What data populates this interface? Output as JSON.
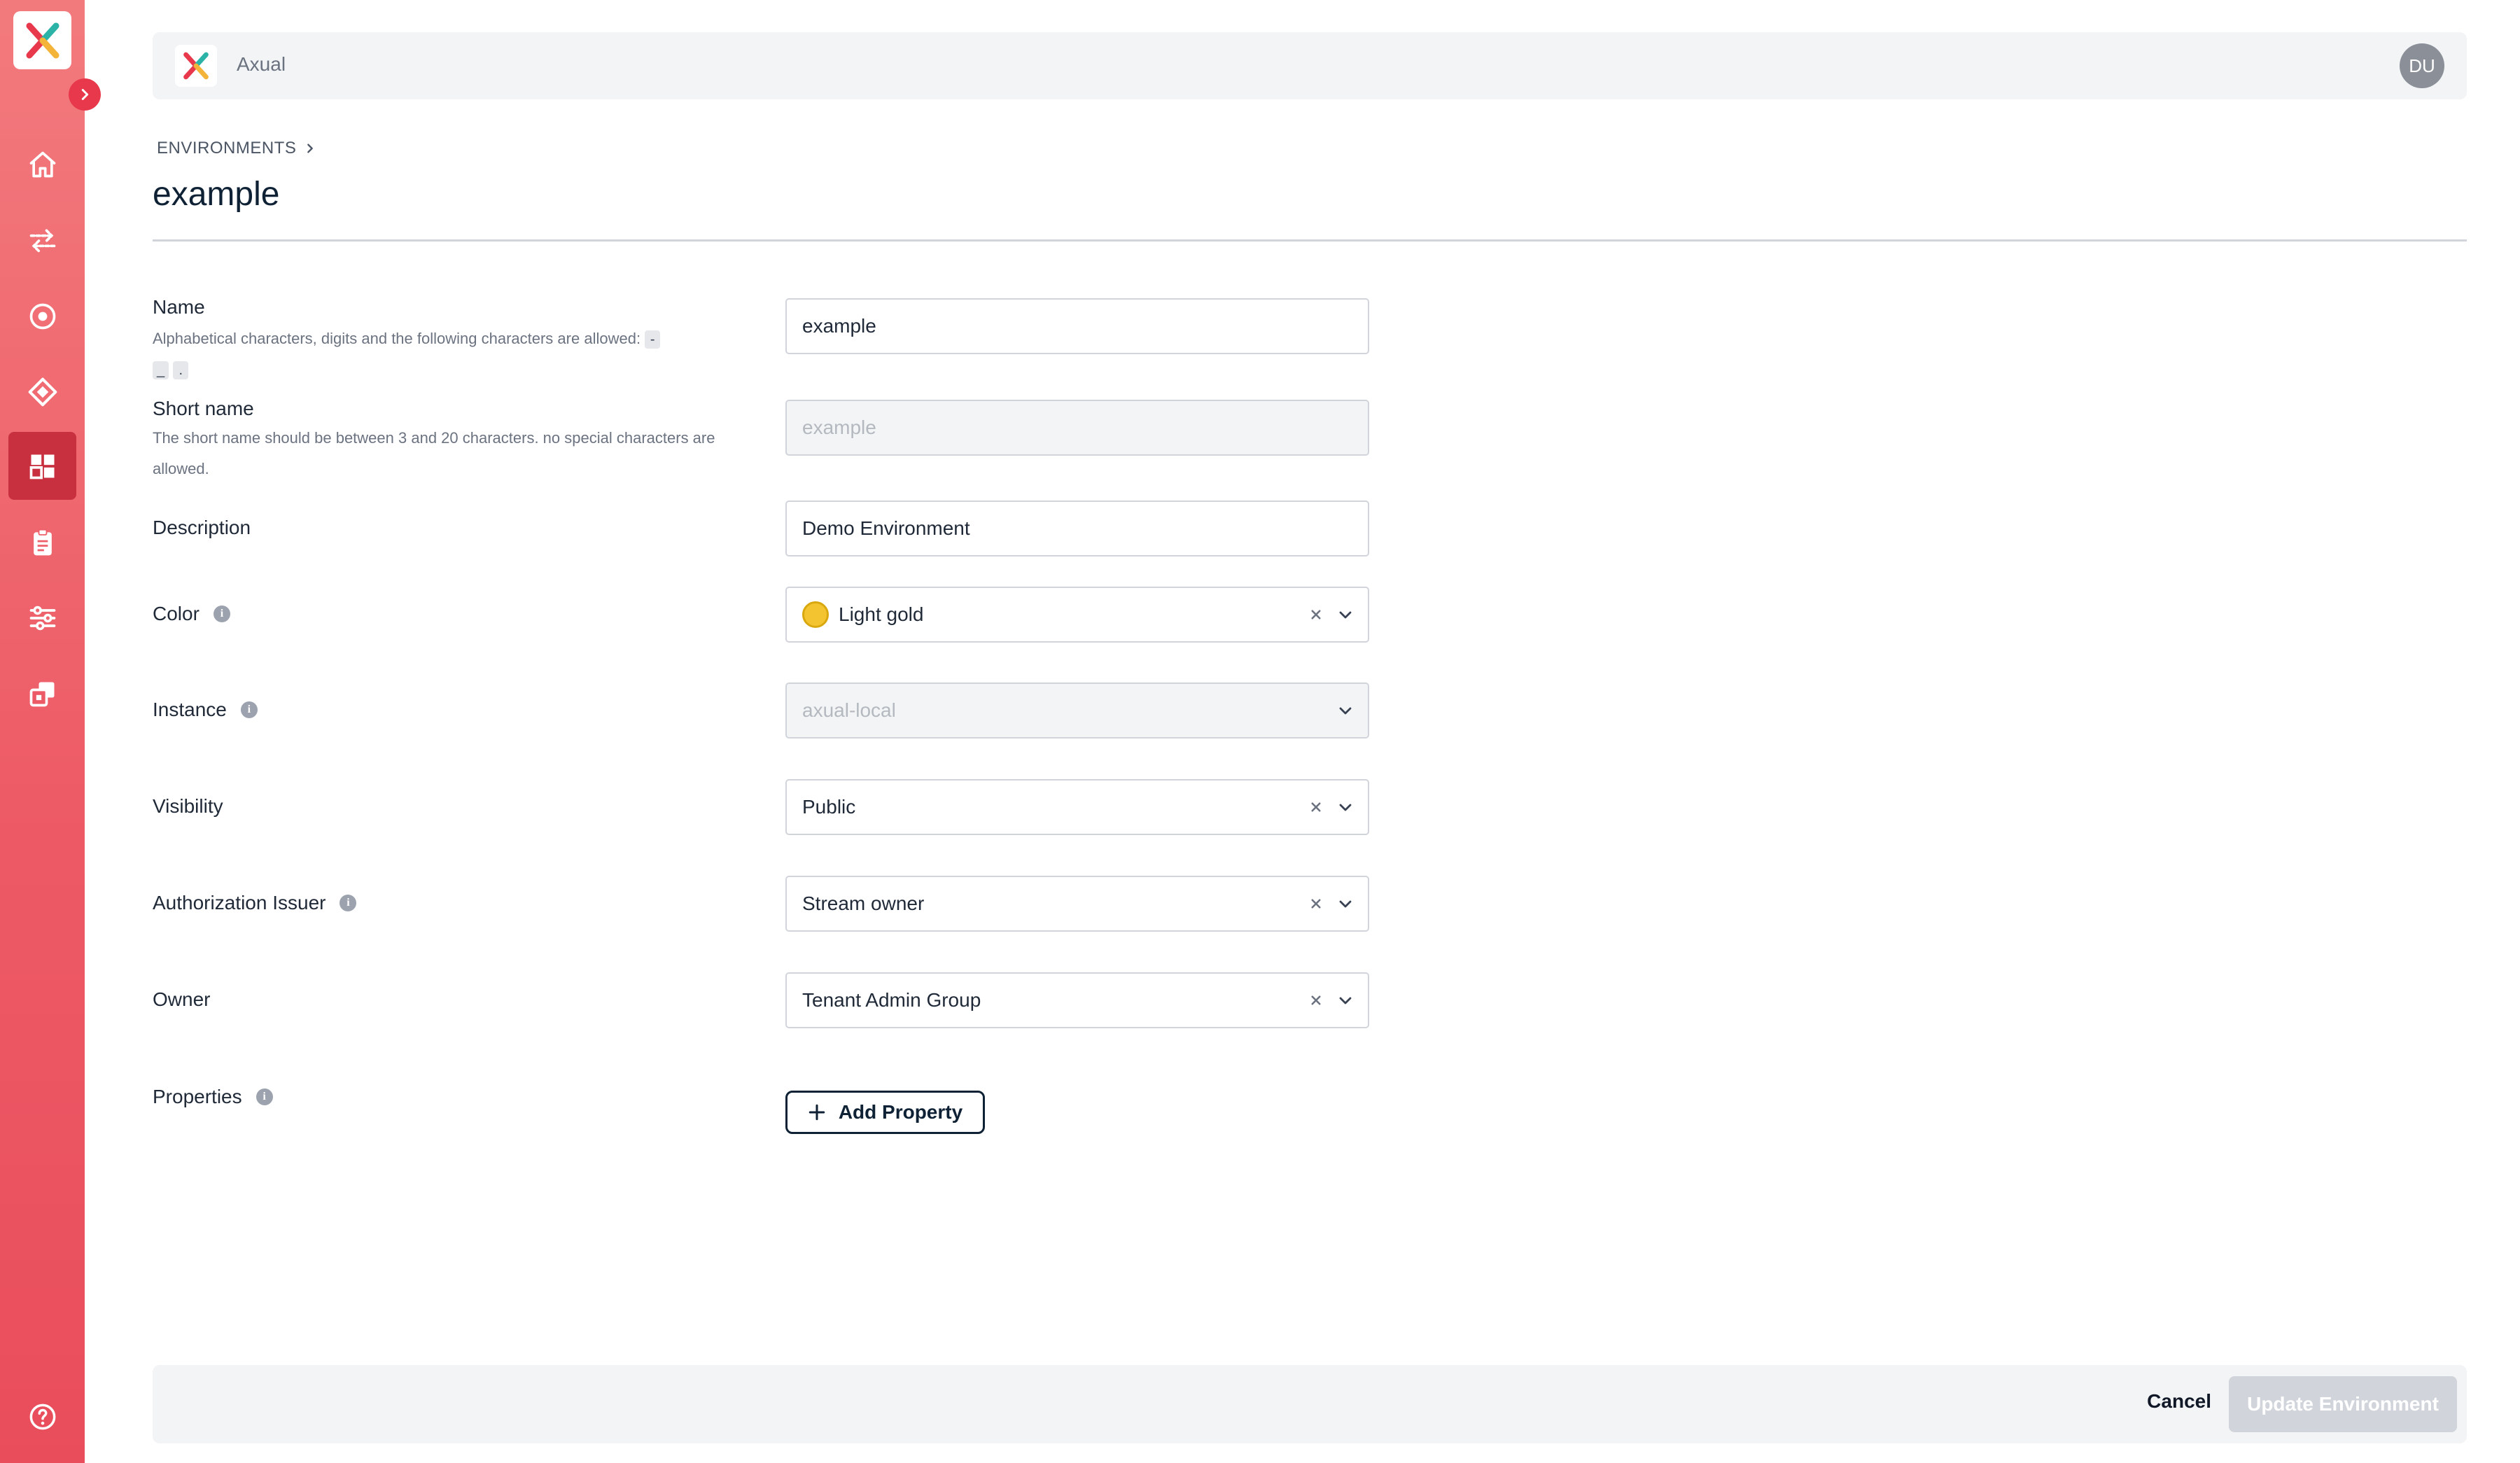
{
  "app": {
    "name": "Axual",
    "user_initials": "DU"
  },
  "sidebar": {
    "items": [
      {
        "icon": "home-icon",
        "active": false
      },
      {
        "icon": "streams-arrows-icon",
        "active": false
      },
      {
        "icon": "target-icon",
        "active": false
      },
      {
        "icon": "diamond-icon",
        "active": false
      },
      {
        "icon": "dashboard-grid-icon",
        "active": true
      },
      {
        "icon": "clipboard-icon",
        "active": false
      },
      {
        "icon": "sliders-icon",
        "active": false
      },
      {
        "icon": "copy-windows-icon",
        "active": false
      }
    ],
    "help_icon": "help-circle-icon"
  },
  "breadcrumb": {
    "section": "ENVIRONMENTS"
  },
  "page": {
    "title": "example"
  },
  "form": {
    "name": {
      "label": "Name",
      "help": "Alphabetical characters, digits and the following characters are allowed:",
      "allowed_chars": [
        "-",
        "_",
        "."
      ],
      "value": "example"
    },
    "short_name": {
      "label": "Short name",
      "help": "The short name should be between 3 and 20 characters. no special characters are allowed.",
      "placeholder": "example"
    },
    "description": {
      "label": "Description",
      "value": "Demo Environment"
    },
    "color": {
      "label": "Color",
      "value": "Light gold",
      "swatch": "#f4c430"
    },
    "instance": {
      "label": "Instance",
      "value": "axual-local"
    },
    "visibility": {
      "label": "Visibility",
      "value": "Public"
    },
    "authorization_issuer": {
      "label": "Authorization Issuer",
      "value": "Stream owner"
    },
    "owner": {
      "label": "Owner",
      "value": "Tenant Admin Group"
    },
    "properties": {
      "label": "Properties",
      "add_label": "Add Property"
    }
  },
  "footer": {
    "cancel_label": "Cancel",
    "submit_label": "Update Environment"
  },
  "colors": {
    "sidebar_gradient_top": "#f27a7d",
    "sidebar_gradient_bottom": "#e94d5c",
    "active_nav": "#c8303f",
    "brand_navy": "#0f2235"
  }
}
